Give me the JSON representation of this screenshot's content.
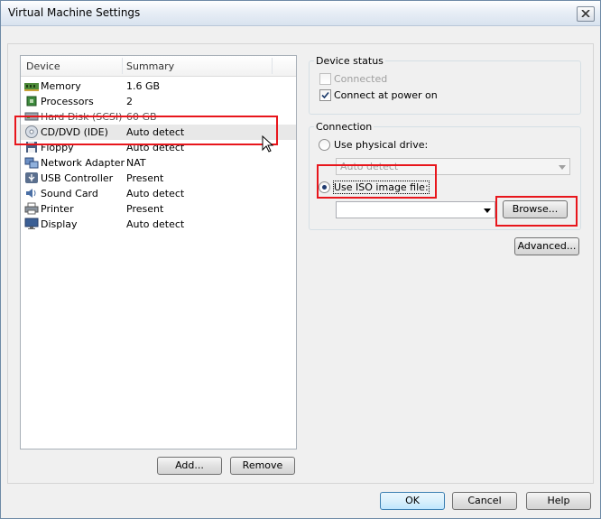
{
  "window": {
    "title": "Virtual Machine Settings"
  },
  "device_list": {
    "columns": [
      "Device",
      "Summary"
    ],
    "rows": [
      {
        "icon": "memory-icon",
        "device": "Memory",
        "summary": "1.6 GB"
      },
      {
        "icon": "processor-icon",
        "device": "Processors",
        "summary": "2"
      },
      {
        "icon": "hard-disk-icon",
        "device": "Hard Disk (SCSI)",
        "summary": "60 GB"
      },
      {
        "icon": "cd-dvd-icon",
        "device": "CD/DVD (IDE)",
        "summary": "Auto detect"
      },
      {
        "icon": "floppy-icon",
        "device": "Floppy",
        "summary": "Auto detect"
      },
      {
        "icon": "network-adapter-icon",
        "device": "Network Adapter",
        "summary": "NAT"
      },
      {
        "icon": "usb-icon",
        "device": "USB Controller",
        "summary": "Present"
      },
      {
        "icon": "sound-card-icon",
        "device": "Sound Card",
        "summary": "Auto detect"
      },
      {
        "icon": "printer-icon",
        "device": "Printer",
        "summary": "Present"
      },
      {
        "icon": "display-icon",
        "device": "Display",
        "summary": "Auto detect"
      }
    ]
  },
  "buttons": {
    "add": "Add...",
    "remove": "Remove",
    "browse": "Browse...",
    "advanced": "Advanced...",
    "ok": "OK",
    "cancel": "Cancel",
    "help": "Help"
  },
  "device_status": {
    "title": "Device status",
    "connected": "Connected",
    "connect_at_power_on": "Connect at power on",
    "connected_checked": false,
    "power_on_checked": true
  },
  "connection": {
    "title": "Connection",
    "physical_drive_label": "Use physical drive:",
    "physical_drive_value": "Auto detect",
    "iso_label": "Use ISO image file:",
    "iso_value": "",
    "selected": "iso"
  },
  "colors": {
    "highlight_red": "#e8161c",
    "selection_gray": "#e8e8e8"
  }
}
